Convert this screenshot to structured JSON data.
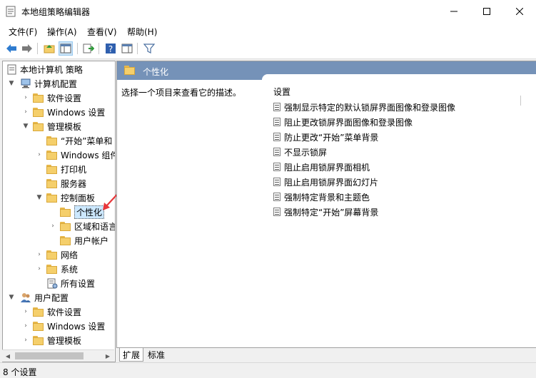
{
  "window": {
    "title": "本地组策略编辑器",
    "controls": [
      "minimize-icon",
      "maximize-icon",
      "close-icon"
    ]
  },
  "menu": [
    {
      "label": "文件(F)"
    },
    {
      "label": "操作(A)"
    },
    {
      "label": "查看(V)"
    },
    {
      "label": "帮助(H)"
    }
  ],
  "toolbar": {
    "icons": [
      "back-arrow-icon",
      "forward-arrow-icon",
      "up-folder-icon",
      "show-hide-tree-icon",
      "export-list-icon",
      "help-icon",
      "action-pane-icon",
      "filter-icon"
    ]
  },
  "tree": {
    "items": [
      {
        "label": "本地计算机 策略",
        "level": 0,
        "expander": "",
        "icon": "policy-document-icon"
      },
      {
        "label": "计算机配置",
        "level": 1,
        "expander": "open",
        "icon": "computer-icon"
      },
      {
        "label": "软件设置",
        "level": 2,
        "expander": "closed",
        "icon": "folder-icon"
      },
      {
        "label": "Windows 设置",
        "level": 2,
        "expander": "closed",
        "icon": "folder-icon"
      },
      {
        "label": "管理模板",
        "level": 2,
        "expander": "open",
        "icon": "folder-icon"
      },
      {
        "label": "“开始”菜单和",
        "level": 3,
        "expander": "",
        "icon": "folder-icon"
      },
      {
        "label": "Windows 组件",
        "level": 3,
        "expander": "closed",
        "icon": "folder-icon"
      },
      {
        "label": "打印机",
        "level": 3,
        "expander": "",
        "icon": "folder-icon"
      },
      {
        "label": "服务器",
        "level": 3,
        "expander": "",
        "icon": "folder-icon"
      },
      {
        "label": "控制面板",
        "level": 3,
        "expander": "open",
        "icon": "folder-icon"
      },
      {
        "label": "个性化",
        "level": 4,
        "expander": "",
        "icon": "folder-icon",
        "selected": true
      },
      {
        "label": "区域和语言",
        "level": 4,
        "expander": "closed",
        "icon": "folder-icon"
      },
      {
        "label": "用户帐户",
        "level": 4,
        "expander": "",
        "icon": "folder-icon"
      },
      {
        "label": "网络",
        "level": 3,
        "expander": "closed",
        "icon": "folder-icon"
      },
      {
        "label": "系统",
        "level": 3,
        "expander": "closed",
        "icon": "folder-icon"
      },
      {
        "label": "所有设置",
        "level": 3,
        "expander": "",
        "icon": "settings-page-icon"
      },
      {
        "label": "用户配置",
        "level": 1,
        "expander": "open",
        "icon": "users-icon"
      },
      {
        "label": "软件设置",
        "level": 2,
        "expander": "closed",
        "icon": "folder-icon"
      },
      {
        "label": "Windows 设置",
        "level": 2,
        "expander": "closed",
        "icon": "folder-icon"
      },
      {
        "label": "管理模板",
        "level": 2,
        "expander": "closed",
        "icon": "folder-icon"
      }
    ]
  },
  "details": {
    "header_title": "个性化",
    "description": "选择一个项目来查看它的描述。",
    "column_header": "设置",
    "settings": [
      "强制显示特定的默认锁屏界面图像和登录图像",
      "阻止更改锁屏界面图像和登录图像",
      "防止更改“开始”菜单背景",
      "不显示锁屏",
      "阻止启用锁屏界面相机",
      "阻止启用锁屏界面幻灯片",
      "强制特定背景和主题色",
      "强制特定“开始”屏幕背景"
    ]
  },
  "tabs": [
    {
      "label": "扩展",
      "active": true
    },
    {
      "label": "标准",
      "active": false
    }
  ],
  "status": {
    "text": "8 个设置"
  },
  "colors": {
    "header_bg": "#7592b8",
    "selection_bg": "#cce8ff",
    "annotation_arrow": "#e8373a"
  }
}
